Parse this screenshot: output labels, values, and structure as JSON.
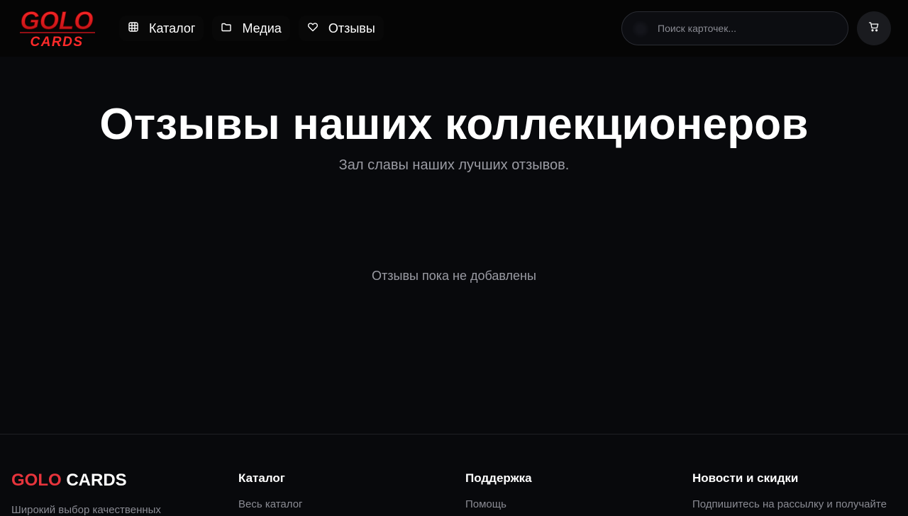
{
  "header": {
    "logo": {
      "line1": "GOLO",
      "line2": "CARDS",
      "color": "#e6161e"
    },
    "nav": [
      {
        "label": "Каталог",
        "icon": "grid-icon"
      },
      {
        "label": "Медиа",
        "icon": "folder-icon"
      },
      {
        "label": "Отзывы",
        "icon": "heart-icon"
      }
    ],
    "search": {
      "placeholder": "Поиск карточек...",
      "value": ""
    },
    "cart_icon": "cart-icon"
  },
  "main": {
    "title": "Отзывы наших коллекционеров",
    "subtitle": "Зал славы наших лучших отзывов.",
    "empty_message": "Отзывы пока не добавлены"
  },
  "footer": {
    "brand": {
      "part1": "GOLO",
      "part2": "CARDS"
    },
    "description": "Широкий выбор качественных",
    "columns": [
      {
        "title": "Каталог",
        "link": "Весь каталог"
      },
      {
        "title": "Поддержка",
        "link": "Помощь"
      },
      {
        "title": "Новости и скидки",
        "text": "Подпишитесь на рассылку и получайте"
      }
    ]
  },
  "colors": {
    "accent": "#e6343c",
    "background": "#08090c",
    "muted": "#9a9ba3"
  }
}
